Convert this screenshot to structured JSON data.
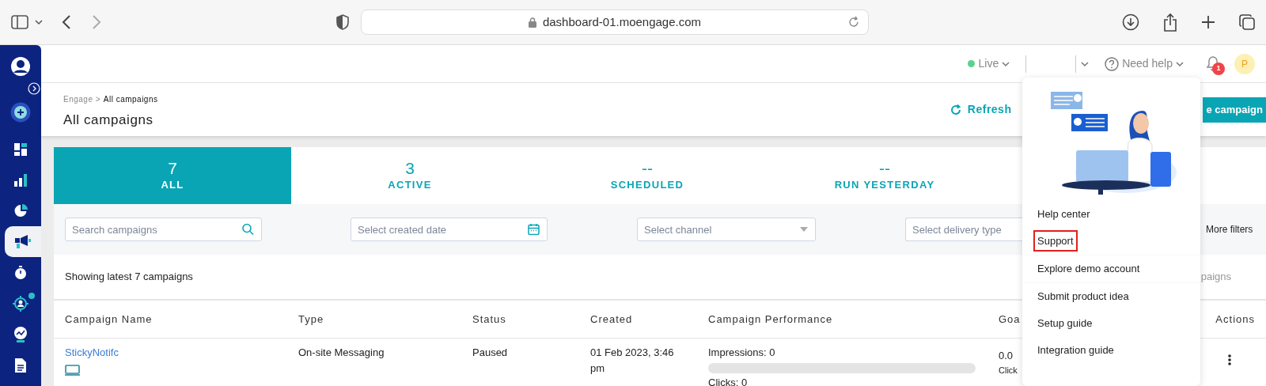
{
  "browser": {
    "address": "dashboard-01.moengage.com"
  },
  "sidebar": {
    "items": [
      {
        "kind": "plus",
        "selected": false,
        "badge": false
      },
      {
        "kind": "grid",
        "selected": false,
        "badge": false
      },
      {
        "kind": "bars",
        "selected": false,
        "badge": false
      },
      {
        "kind": "pie",
        "selected": false,
        "badge": false
      },
      {
        "kind": "megaphone",
        "selected": true,
        "badge": false
      },
      {
        "kind": "stopwatch",
        "selected": false,
        "badge": false
      },
      {
        "kind": "target",
        "selected": false,
        "badge": true
      },
      {
        "kind": "trend",
        "selected": false,
        "badge": false
      },
      {
        "kind": "document",
        "selected": false,
        "badge": false
      }
    ]
  },
  "header": {
    "environment": "Live",
    "need_help": "Need help",
    "notification_count": "1",
    "avatar_initial": "P"
  },
  "page": {
    "breadcrumb_parent": "Engage >",
    "breadcrumb_current": "All campaigns",
    "title": "All campaigns",
    "refresh": "Refresh",
    "create_button": "e campaign"
  },
  "tabs": [
    {
      "count": "7",
      "label": "ALL",
      "selected": true
    },
    {
      "count": "3",
      "label": "ACTIVE",
      "selected": false
    },
    {
      "count": "--",
      "label": "SCHEDULED",
      "selected": false
    },
    {
      "count": "--",
      "label": "RUN YESTERDAY",
      "selected": false
    }
  ],
  "filters": {
    "search": {
      "placeholder": "Search campaigns"
    },
    "created_date": {
      "placeholder": "Select created date"
    },
    "channel": {
      "placeholder": "Select channel"
    },
    "delivery_type": {
      "placeholder": "Select delivery type"
    },
    "more_filters": "More filters"
  },
  "summary": "Showing latest 7 campaigns",
  "summary_right": "paigns",
  "table": {
    "columns": [
      "Campaign Name",
      "Type",
      "Status",
      "Created",
      "Campaign Performance",
      "Goa",
      "Actions"
    ],
    "rows": [
      {
        "name": "StickyNotifc",
        "type": "On-site Messaging",
        "status": "Paused",
        "created": "01 Feb 2023, 3:46 pm",
        "impressions": "Impressions: 0",
        "level": 0,
        "clicks": "Clicks: 0",
        "goal": "0.0",
        "goal_label": "Click"
      }
    ]
  },
  "help_menu": {
    "items": [
      {
        "label": "Help center",
        "highlighted": false,
        "divider_after": false
      },
      {
        "label": "Support",
        "highlighted": true,
        "divider_after": true
      },
      {
        "label": "Explore demo account",
        "highlighted": false,
        "divider_after": true
      },
      {
        "label": "Submit product idea",
        "highlighted": false,
        "divider_after": false
      },
      {
        "label": "Setup guide",
        "highlighted": false,
        "divider_after": false
      },
      {
        "label": "Integration guide",
        "highlighted": false,
        "divider_after": false
      }
    ]
  }
}
